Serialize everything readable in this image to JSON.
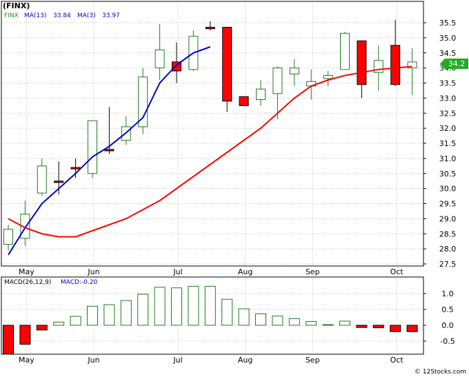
{
  "title": "(FINX)",
  "watermark": "© 12Stocks.com",
  "colors": {
    "up": "#1f7a1f",
    "down_fill": "#ff0000",
    "ma13": "#0000cc",
    "ma3": "#ff0000",
    "legend_ma": "#0000cc",
    "last_price_bg": "#22aa22",
    "macd_bar": "#1f7a1f",
    "macd_neg_fill": "#ff0000",
    "grid": "#bbbbbb",
    "frame": "#000000"
  },
  "legend": {
    "symbol": "FINX",
    "ma13_label": "MA(13)",
    "ma13_value": "33.84",
    "ma3_label": "MA(3)",
    "ma3_value": "33.97"
  },
  "last_price": "34.2",
  "macd_legend": {
    "label": "MACD(26,12,9)",
    "value_label": "MACD:-0.20"
  },
  "chart_data": [
    {
      "type": "candlestick",
      "title": "(FINX)",
      "x_labels": [
        "May",
        "Jun",
        "Jul",
        "Aug",
        "Sep",
        "Oct"
      ],
      "label_positions": [
        1,
        5,
        10,
        14,
        18,
        23
      ],
      "ylim": [
        27.5,
        35.5
      ],
      "yticks": [
        27.5,
        28.0,
        28.5,
        29.0,
        29.5,
        30.0,
        30.5,
        31.0,
        31.5,
        32.0,
        32.5,
        33.0,
        33.5,
        34.0,
        34.5,
        35.0,
        35.5
      ],
      "grid": true,
      "candles": [
        {
          "o": 28.15,
          "c": 28.65,
          "h": 28.8,
          "l": 27.95
        },
        {
          "o": 28.35,
          "c": 29.15,
          "h": 29.6,
          "l": 28.1
        },
        {
          "o": 29.85,
          "c": 30.75,
          "h": 31.0,
          "l": 29.75
        },
        {
          "o": 30.25,
          "c": 30.2,
          "h": 30.9,
          "l": 29.8
        },
        {
          "o": 30.7,
          "c": 30.65,
          "h": 31.0,
          "l": 30.35
        },
        {
          "o": 30.5,
          "c": 32.25,
          "h": 32.25,
          "l": 30.35
        },
        {
          "o": 31.3,
          "c": 31.25,
          "h": 32.7,
          "l": 31.15
        },
        {
          "o": 31.6,
          "c": 32.05,
          "h": 32.4,
          "l": 31.45
        },
        {
          "o": 32.05,
          "c": 33.7,
          "h": 34.0,
          "l": 31.8
        },
        {
          "o": 34.0,
          "c": 34.6,
          "h": 35.45,
          "l": 33.6
        },
        {
          "o": 34.2,
          "c": 33.9,
          "h": 34.85,
          "l": 33.5
        },
        {
          "o": 33.95,
          "c": 35.05,
          "h": 35.25,
          "l": 33.9
        },
        {
          "o": 35.35,
          "c": 35.3,
          "h": 35.55,
          "l": 35.25
        },
        {
          "o": 35.35,
          "c": 32.9,
          "h": 35.35,
          "l": 32.55
        },
        {
          "o": 33.05,
          "c": 32.75,
          "h": 33.05,
          "l": 32.75
        },
        {
          "o": 32.95,
          "c": 33.3,
          "h": 33.6,
          "l": 32.75
        },
        {
          "o": 33.15,
          "c": 34.0,
          "h": 34.05,
          "l": 32.3
        },
        {
          "o": 33.8,
          "c": 34.0,
          "h": 34.3,
          "l": 33.4
        },
        {
          "o": 33.4,
          "c": 33.55,
          "h": 33.95,
          "l": 32.95
        },
        {
          "o": 33.65,
          "c": 33.75,
          "h": 33.9,
          "l": 33.4
        },
        {
          "o": 33.95,
          "c": 35.15,
          "h": 35.2,
          "l": 33.95
        },
        {
          "o": 34.9,
          "c": 33.45,
          "h": 34.9,
          "l": 33.0
        },
        {
          "o": 33.85,
          "c": 34.25,
          "h": 34.75,
          "l": 33.25
        },
        {
          "o": 34.75,
          "c": 33.45,
          "h": 35.6,
          "l": 33.4
        },
        {
          "o": 34.0,
          "c": 34.2,
          "h": 34.65,
          "l": 33.1
        }
      ],
      "series": [
        {
          "name": "MA(13)",
          "start": 0,
          "values": [
            27.8,
            28.7,
            29.5,
            30.0,
            30.5,
            31.05,
            31.4,
            31.85,
            32.35,
            33.5,
            34.1,
            34.5,
            34.7
          ]
        },
        {
          "name": "MA(13)",
          "start": 0,
          "values": [
            null,
            null,
            null,
            null,
            null,
            null,
            null,
            null,
            null,
            null,
            null,
            null,
            null,
            null,
            null,
            null,
            null,
            null,
            null,
            null,
            null,
            null,
            null,
            null,
            null
          ]
        },
        {
          "name": "MA(3)",
          "start": 0,
          "values": [
            29.0,
            28.7,
            28.5,
            28.4,
            28.4,
            28.6,
            28.8,
            29.0,
            29.3,
            29.6,
            30.0,
            30.4,
            30.8,
            31.2,
            31.6,
            32.0,
            32.5,
            33.0,
            33.4,
            33.6,
            33.75,
            33.85,
            33.95,
            34.0,
            34.05
          ]
        }
      ]
    },
    {
      "type": "bar",
      "title": "MACD(26,12,9)",
      "value_label": "MACD:-0.20",
      "x_labels": [
        "May",
        "Jun",
        "Jul",
        "Aug",
        "Sep",
        "Oct"
      ],
      "ylim": [
        -1.0,
        1.3
      ],
      "yticks": [
        -0.5,
        0.0,
        0.5,
        1.0
      ],
      "ytick_labels": [
        "-0.5",
        "0.0",
        "0.5",
        "1.0"
      ],
      "values": [
        -1.0,
        -0.6,
        -0.15,
        0.1,
        0.28,
        0.6,
        0.65,
        0.78,
        0.98,
        1.2,
        1.18,
        1.23,
        1.23,
        0.82,
        0.52,
        0.36,
        0.29,
        0.21,
        0.12,
        0.02,
        0.13,
        -0.07,
        -0.08,
        -0.2,
        -0.2
      ]
    }
  ]
}
